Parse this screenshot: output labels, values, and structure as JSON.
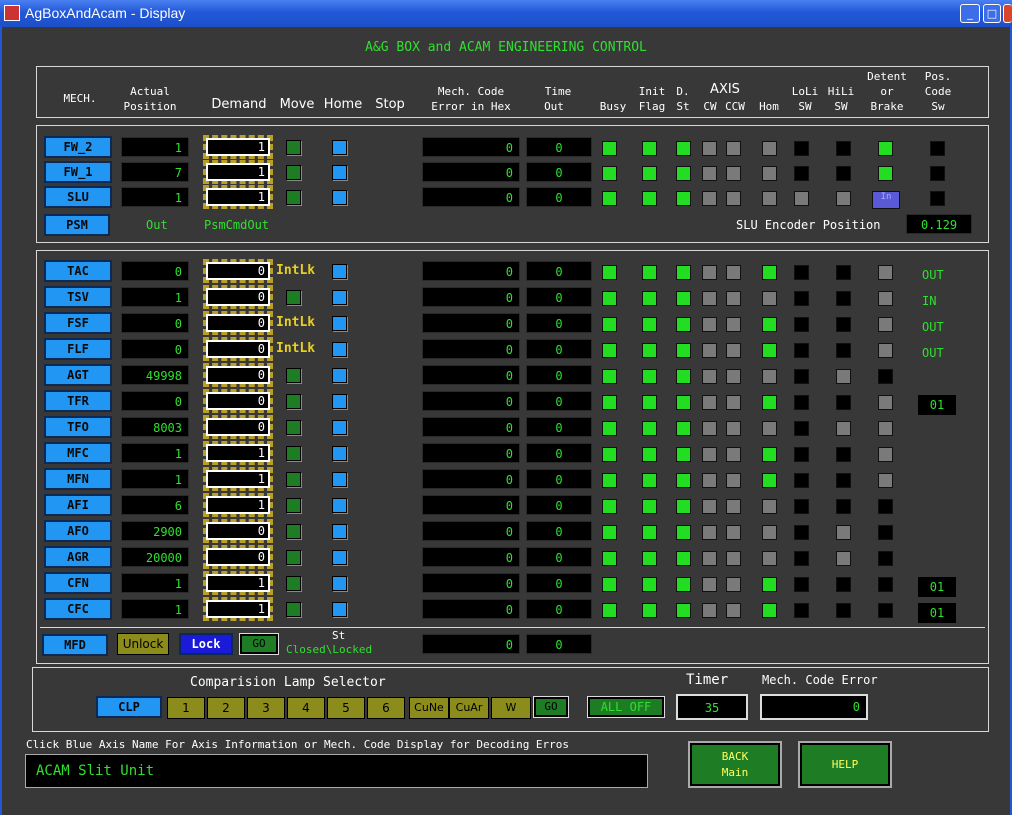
{
  "window": {
    "title": "AgBoxAndAcam - Display",
    "min": "_",
    "max": "□",
    "close": "✕"
  },
  "main_title": "A&G BOX and ACAM ENGINEERING CONTROL",
  "headers": {
    "mech": "MECH.",
    "actual1": "Actual",
    "actual2": "Position",
    "demand": "Demand",
    "move": "Move",
    "home": "Home",
    "stop": "Stop",
    "mcode1": "Mech. Code",
    "mcode2": "Error in Hex",
    "time1": "Time",
    "time2": "Out",
    "busy": "Busy",
    "init1": "Init",
    "init2": "Flag",
    "dst1": "D.",
    "dst2": "St",
    "axis": "AXIS",
    "cw": "CW",
    "ccw": "CCW",
    "hom": "Hom",
    "loli1": "LoLi",
    "loli2": "SW",
    "hili1": "HiLi",
    "hili2": "SW",
    "detent1": "Detent",
    "detent2": "or",
    "detent3": "Brake",
    "pos1": "Pos.",
    "pos2": "Code",
    "pos3": "Sw"
  },
  "top_rows": [
    {
      "name": "FW_2",
      "actual": "1",
      "demand": "1",
      "mcode": "0",
      "time": "0"
    },
    {
      "name": "FW_1",
      "actual": "7",
      "demand": "1",
      "mcode": "0",
      "time": "0"
    },
    {
      "name": "SLU",
      "actual": "1",
      "demand": "1",
      "mcode": "0",
      "time": "0"
    }
  ],
  "psm": {
    "name": "PSM",
    "out": "Out",
    "cmd": "PsmCmdOut"
  },
  "slu_encoder": {
    "label": "SLU Encoder Position",
    "value": "0.129"
  },
  "slu_detent_text": "In",
  "bottom_rows": [
    {
      "name": "TAC",
      "actual": "0",
      "demand": "0",
      "move": "IntLk",
      "mcode": "0",
      "time": "0",
      "pos": "OUT",
      "poscode": ""
    },
    {
      "name": "TSV",
      "actual": "1",
      "demand": "0",
      "move": "",
      "mcode": "0",
      "time": "0",
      "pos": "IN",
      "poscode": ""
    },
    {
      "name": "FSF",
      "actual": "0",
      "demand": "0",
      "move": "IntLk",
      "mcode": "0",
      "time": "0",
      "pos": "OUT",
      "poscode": ""
    },
    {
      "name": "FLF",
      "actual": "0",
      "demand": "0",
      "move": "IntLk",
      "mcode": "0",
      "time": "0",
      "pos": "OUT",
      "poscode": ""
    },
    {
      "name": "AGT",
      "actual": "49998",
      "demand": "0",
      "move": "",
      "mcode": "0",
      "time": "0",
      "pos": "",
      "poscode": ""
    },
    {
      "name": "TFR",
      "actual": "0",
      "demand": "0",
      "move": "",
      "mcode": "0",
      "time": "0",
      "pos": "",
      "poscode": "01"
    },
    {
      "name": "TFO",
      "actual": "8003",
      "demand": "0",
      "move": "",
      "mcode": "0",
      "time": "0",
      "pos": "",
      "poscode": ""
    },
    {
      "name": "MFC",
      "actual": "1",
      "demand": "1",
      "move": "",
      "mcode": "0",
      "time": "0",
      "pos": "",
      "poscode": ""
    },
    {
      "name": "MFN",
      "actual": "1",
      "demand": "1",
      "move": "",
      "mcode": "0",
      "time": "0",
      "pos": "",
      "poscode": ""
    },
    {
      "name": "AFI",
      "actual": "6",
      "demand": "1",
      "move": "",
      "mcode": "0",
      "time": "0",
      "pos": "",
      "poscode": ""
    },
    {
      "name": "AFO",
      "actual": "2900",
      "demand": "0",
      "move": "",
      "mcode": "0",
      "time": "0",
      "pos": "",
      "poscode": ""
    },
    {
      "name": "AGR",
      "actual": "20000",
      "demand": "0",
      "move": "",
      "mcode": "0",
      "time": "0",
      "pos": "",
      "poscode": ""
    },
    {
      "name": "CFN",
      "actual": "1",
      "demand": "1",
      "move": "",
      "mcode": "0",
      "time": "0",
      "pos": "",
      "poscode": "01"
    },
    {
      "name": "CFC",
      "actual": "1",
      "demand": "1",
      "move": "",
      "mcode": "0",
      "time": "0",
      "pos": "",
      "poscode": "01"
    }
  ],
  "mfd": {
    "name": "MFD",
    "unlock": "Unlock",
    "lock": "Lock",
    "go": "GO",
    "st": "St",
    "status": "Closed\\Locked",
    "mcode": "0",
    "time": "0"
  },
  "lamp_selector": {
    "title": "Comparision Lamp Selector",
    "clp": "CLP",
    "buttons": [
      "1",
      "2",
      "3",
      "4",
      "5",
      "6",
      "CuNe",
      "CuAr",
      "W"
    ],
    "go": "GO",
    "all_off": "ALL OFF"
  },
  "timer": {
    "label": "Timer",
    "value": "35"
  },
  "mech_code_error": {
    "label": "Mech. Code Error",
    "value": "0"
  },
  "hint": "Click Blue Axis Name For Axis Information or Mech. Code Display for Decoding Erros",
  "status_text": "ACAM Slit Unit",
  "back_button": "BACK\nMain",
  "help_button": "HELP"
}
